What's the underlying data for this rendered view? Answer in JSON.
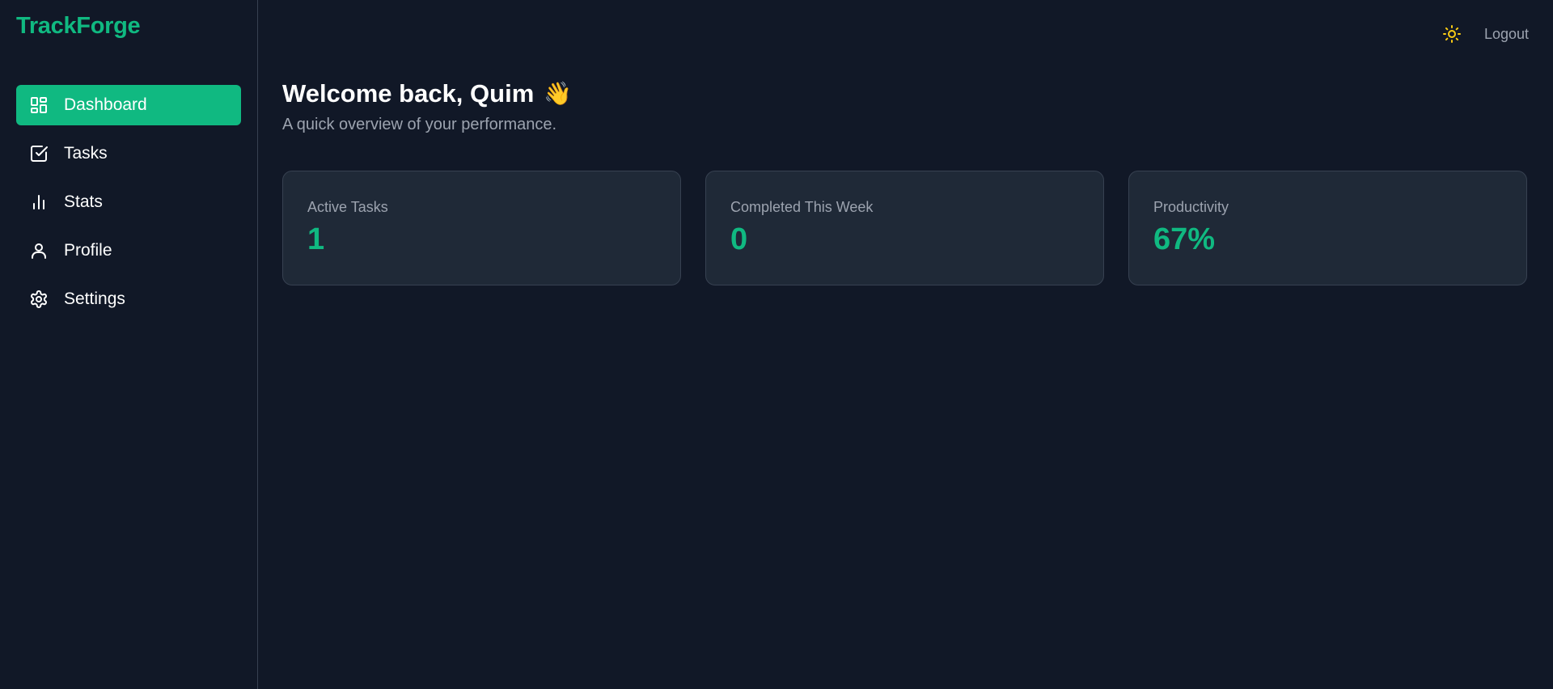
{
  "brand": {
    "name": "TrackForge",
    "color": "#10b981"
  },
  "sidebar": {
    "items": [
      {
        "label": "Dashboard",
        "icon": "dashboard-icon",
        "active": true
      },
      {
        "label": "Tasks",
        "icon": "check-square-icon",
        "active": false
      },
      {
        "label": "Stats",
        "icon": "bar-chart-icon",
        "active": false
      },
      {
        "label": "Profile",
        "icon": "user-icon",
        "active": false
      },
      {
        "label": "Settings",
        "icon": "gear-icon",
        "active": false
      }
    ]
  },
  "header": {
    "theme_toggle_icon": "sun-icon",
    "logout_label": "Logout"
  },
  "main": {
    "welcome_title": "Welcome back, Quim",
    "welcome_emoji": "👋",
    "subtitle": "A quick overview of your performance.",
    "stats": [
      {
        "label": "Active Tasks",
        "value": "1"
      },
      {
        "label": "Completed This Week",
        "value": "0"
      },
      {
        "label": "Productivity",
        "value": "67%"
      }
    ]
  },
  "colors": {
    "background": "#111827",
    "card_background": "#1f2937",
    "accent": "#10b981",
    "muted_text": "#9ca3af",
    "sun": "#facc15"
  }
}
